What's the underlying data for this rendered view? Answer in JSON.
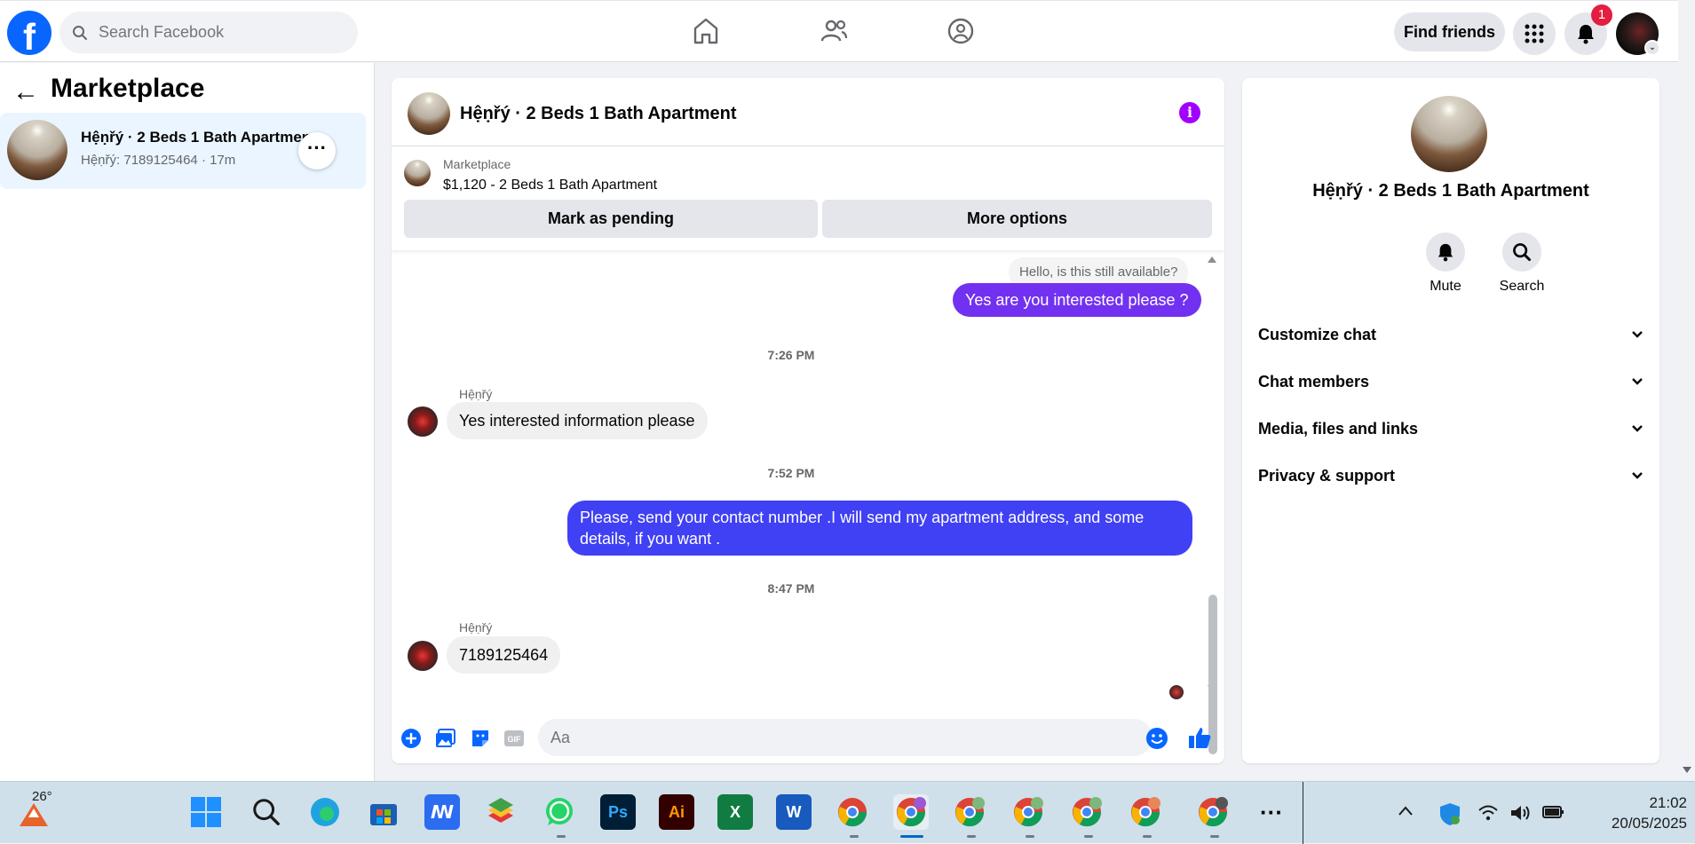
{
  "header": {
    "search_placeholder": "Search Facebook",
    "find_friends_label": "Find friends",
    "notification_count": "1"
  },
  "sidebar": {
    "title": "Marketplace",
    "conversation": {
      "title": "Hệṇřý · 2 Beds 1 Bath Apartment",
      "subtitle": "Hệṇřý: 7189125464 · 17m"
    }
  },
  "chat": {
    "title": "Hệṇřý · 2 Beds 1 Bath Apartment",
    "listing": {
      "category": "Marketplace",
      "description": "$1,120 - 2 Beds 1 Bath Apartment",
      "mark_pending_label": "Mark as pending",
      "more_options_label": "More options"
    },
    "messages": {
      "prefill": "Hello, is this still available?",
      "reply1": "Yes are you interested please ?",
      "time1": "7:26 PM",
      "sender1": "Hệṇřý",
      "incoming1": "Yes interested information please",
      "time2": "7:52 PM",
      "reply2": "Please, send your contact number .I will send my apartment address, and some details, if you want .",
      "time3": "8:47 PM",
      "sender2": "Hệṇřý",
      "incoming2": "7189125464"
    },
    "composer_placeholder": "Aa",
    "colors": {
      "reply1_bubble": "#7231f0",
      "reply2_bubble": "#4040f4",
      "accent": "#0866ff"
    }
  },
  "info_panel": {
    "title": "Hệṇřý · 2 Beds 1 Bath Apartment",
    "mute_label": "Mute",
    "search_label": "Search",
    "sections": [
      "Customize chat",
      "Chat members",
      "Media, files and links",
      "Privacy & support"
    ]
  },
  "taskbar": {
    "weather_temp": "26°",
    "time": "21:02",
    "date": "20/05/2025"
  }
}
